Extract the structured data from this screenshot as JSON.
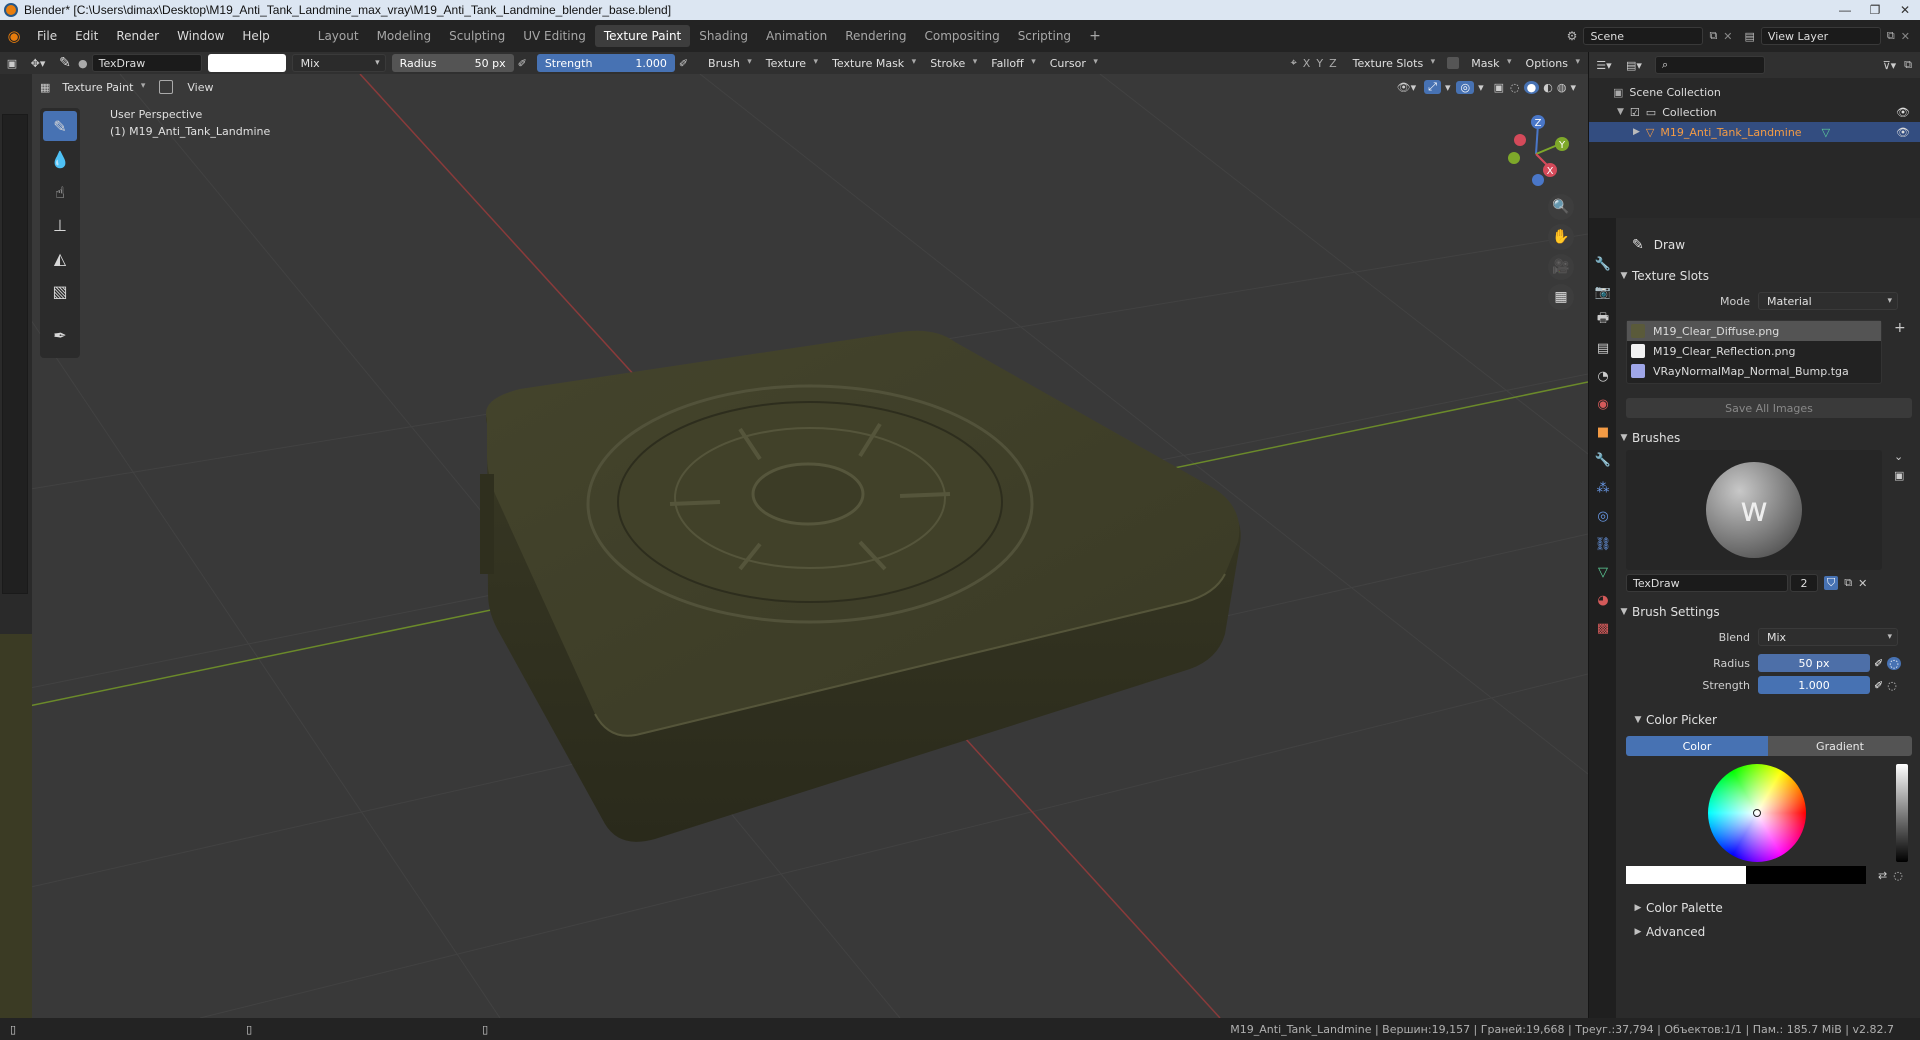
{
  "window": {
    "title": "Blender* [C:\\Users\\dimax\\Desktop\\M19_Anti_Tank_Landmine_max_vray\\M19_Anti_Tank_Landmine_blender_base.blend]",
    "controls": [
      "—",
      "❐",
      "✕"
    ]
  },
  "menu": {
    "items": [
      "File",
      "Edit",
      "Render",
      "Window",
      "Help"
    ]
  },
  "workspaces": {
    "tabs": [
      "Layout",
      "Modeling",
      "Sculpting",
      "UV Editing",
      "Texture Paint",
      "Shading",
      "Animation",
      "Rendering",
      "Compositing",
      "Scripting"
    ],
    "active": "Texture Paint",
    "add": "+"
  },
  "scene": {
    "name": "Scene",
    "view_layer": "View Layer"
  },
  "toolheader": {
    "brush_name": "TexDraw",
    "blend": "Mix",
    "radius_label": "Radius",
    "radius_value": "50 px",
    "strength_label": "Strength",
    "strength_value": "1.000",
    "menus": [
      "Brush",
      "Texture",
      "Texture Mask",
      "Stroke",
      "Falloff",
      "Cursor"
    ],
    "axes": [
      "X",
      "Y",
      "Z"
    ],
    "right_menus": [
      "Texture Slots",
      "Mask",
      "Options"
    ]
  },
  "viewport": {
    "mode": "Texture Paint",
    "view_menu": "View",
    "perspective": "User Perspective",
    "object_label": "(1) M19_Anti_Tank_Landmine",
    "gizmo": {
      "x": "X",
      "y": "Y",
      "z": "Z"
    }
  },
  "outliner": {
    "scene_collection": "Scene Collection",
    "collection": "Collection",
    "object": "M19_Anti_Tank_Landmine"
  },
  "properties": {
    "tool_name": "Draw",
    "texture_slots": {
      "header": "Texture Slots",
      "mode_label": "Mode",
      "mode_value": "Material",
      "images": [
        {
          "name": "M19_Clear_Diffuse.png",
          "color": "#5a5a3a"
        },
        {
          "name": "M19_Clear_Reflection.png",
          "color": "#f2f2f2"
        },
        {
          "name": "VRayNormalMap_Normal_Bump.tga",
          "color": "#9fa6e8"
        }
      ],
      "save_all": "Save All Images"
    },
    "brushes": {
      "header": "Brushes",
      "name": "TexDraw",
      "users": "2"
    },
    "brush_settings": {
      "header": "Brush Settings",
      "blend_label": "Blend",
      "blend_value": "Mix",
      "radius_label": "Radius",
      "radius_value": "50 px",
      "strength_label": "Strength",
      "strength_value": "1.000"
    },
    "color_picker": {
      "header": "Color Picker",
      "tabs": [
        "Color",
        "Gradient"
      ],
      "active": "Color"
    },
    "color_palette": "Color Palette",
    "advanced": "Advanced"
  },
  "status": {
    "stats": "M19_Anti_Tank_Landmine | Вершин:19,157 | Граней:19,668 | Треуг.:37,794 | Объектов:1/1 | Пам.: 185.7 MiB | v2.82.7"
  },
  "colors": {
    "accent": "#4772b3",
    "selection": "#334d80",
    "object_orange": "#f39b45",
    "mesh": "#3f3f28"
  }
}
